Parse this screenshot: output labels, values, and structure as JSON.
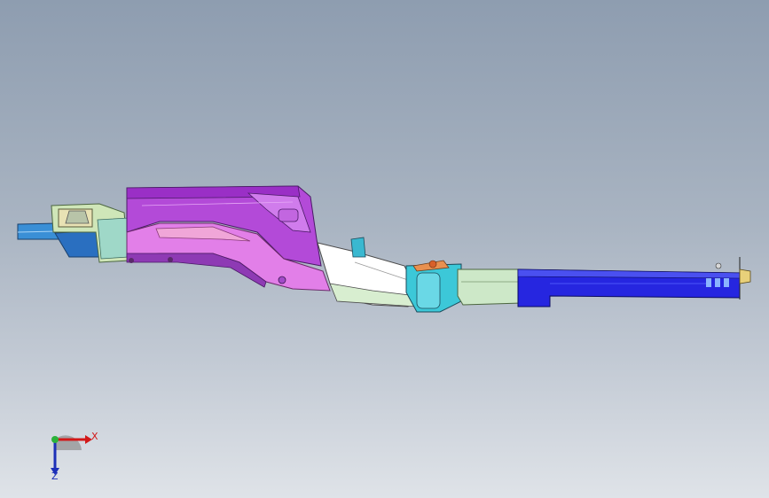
{
  "viewport": {
    "background_top": "#8e9db0",
    "background_bottom": "#dfe3e8"
  },
  "model": {
    "name_icon": "chassis-frame-rail-model",
    "parts": [
      {
        "id": "front-bumper-bracket",
        "color": "#3a8fd6"
      },
      {
        "id": "front-crossmember",
        "color": "#c8e6b8"
      },
      {
        "id": "front-rail-upper",
        "color": "#b34ad8"
      },
      {
        "id": "front-rail-lower",
        "color": "#e27fe8"
      },
      {
        "id": "kickup-section",
        "color": "#ffffff"
      },
      {
        "id": "mid-mount-bracket",
        "color": "#3cc8d8"
      },
      {
        "id": "mid-rail",
        "color": "#cde8c8"
      },
      {
        "id": "rear-rail",
        "color": "#2626e0"
      },
      {
        "id": "rear-end-bracket",
        "color": "#e8d07a"
      }
    ]
  },
  "triad": {
    "x_label": "X",
    "z_label": "Z",
    "x_color": "#d21818",
    "y_color": "#2bb23a",
    "z_color": "#1c2fb8"
  }
}
